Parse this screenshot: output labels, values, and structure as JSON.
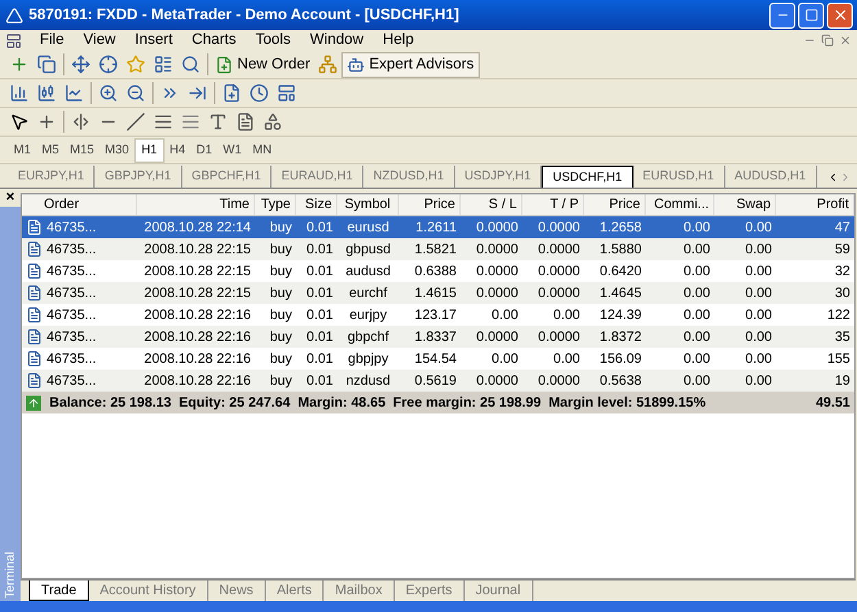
{
  "window": {
    "title": "5870191: FXDD - MetaTrader - Demo Account - [USDCHF,H1]"
  },
  "menu": [
    "File",
    "View",
    "Insert",
    "Charts",
    "Tools",
    "Window",
    "Help"
  ],
  "toolbar": {
    "new_order": "New Order",
    "expert_advisors": "Expert Advisors"
  },
  "timeframes": [
    {
      "label": "M1",
      "selected": false
    },
    {
      "label": "M5",
      "selected": false
    },
    {
      "label": "M15",
      "selected": false
    },
    {
      "label": "M30",
      "selected": false
    },
    {
      "label": "H1",
      "selected": true
    },
    {
      "label": "H4",
      "selected": false
    },
    {
      "label": "D1",
      "selected": false
    },
    {
      "label": "W1",
      "selected": false
    },
    {
      "label": "MN",
      "selected": false
    }
  ],
  "chart_tabs": [
    {
      "label": "EURJPY,H1",
      "selected": false
    },
    {
      "label": "GBPJPY,H1",
      "selected": false
    },
    {
      "label": "GBPCHF,H1",
      "selected": false
    },
    {
      "label": "EURAUD,H1",
      "selected": false
    },
    {
      "label": "NZDUSD,H1",
      "selected": false
    },
    {
      "label": "USDJPY,H1",
      "selected": false
    },
    {
      "label": "USDCHF,H1",
      "selected": true
    },
    {
      "label": "EURUSD,H1",
      "selected": false
    },
    {
      "label": "AUDUSD,H1",
      "selected": false
    }
  ],
  "terminal": {
    "close": "×",
    "side_label": "Terminal",
    "columns": [
      "Order",
      "Time",
      "Type",
      "Size",
      "Symbol",
      "Price",
      "S / L",
      "T / P",
      "Price",
      "Commi...",
      "Swap",
      "Profit"
    ],
    "rows": [
      {
        "selected": true,
        "cells": [
          "46735...",
          "2008.10.28 22:14",
          "buy",
          "0.01",
          "eurusd",
          "1.2611",
          "0.0000",
          "0.0000",
          "1.2658",
          "0.00",
          "0.00",
          "47"
        ]
      },
      {
        "selected": false,
        "cells": [
          "46735...",
          "2008.10.28 22:15",
          "buy",
          "0.01",
          "gbpusd",
          "1.5821",
          "0.0000",
          "0.0000",
          "1.5880",
          "0.00",
          "0.00",
          "59"
        ]
      },
      {
        "selected": false,
        "cells": [
          "46735...",
          "2008.10.28 22:15",
          "buy",
          "0.01",
          "audusd",
          "0.6388",
          "0.0000",
          "0.0000",
          "0.6420",
          "0.00",
          "0.00",
          "32"
        ]
      },
      {
        "selected": false,
        "cells": [
          "46735...",
          "2008.10.28 22:15",
          "buy",
          "0.01",
          "eurchf",
          "1.4615",
          "0.0000",
          "0.0000",
          "1.4645",
          "0.00",
          "0.00",
          "30"
        ]
      },
      {
        "selected": false,
        "cells": [
          "46735...",
          "2008.10.28 22:16",
          "buy",
          "0.01",
          "eurjpy",
          "123.17",
          "0.00",
          "0.00",
          "124.39",
          "0.00",
          "0.00",
          "122"
        ]
      },
      {
        "selected": false,
        "cells": [
          "46735...",
          "2008.10.28 22:16",
          "buy",
          "0.01",
          "gbpchf",
          "1.8337",
          "0.0000",
          "0.0000",
          "1.8372",
          "0.00",
          "0.00",
          "35"
        ]
      },
      {
        "selected": false,
        "cells": [
          "46735...",
          "2008.10.28 22:16",
          "buy",
          "0.01",
          "gbpjpy",
          "154.54",
          "0.00",
          "0.00",
          "156.09",
          "0.00",
          "0.00",
          "155"
        ]
      },
      {
        "selected": false,
        "cells": [
          "46735...",
          "2008.10.28 22:16",
          "buy",
          "0.01",
          "nzdusd",
          "0.5619",
          "0.0000",
          "0.0000",
          "0.5638",
          "0.00",
          "0.00",
          "19"
        ]
      }
    ],
    "summary": {
      "text": "Balance: 25 198.13  Equity: 25 247.64  Margin: 48.65  Free margin: 25 198.99  Margin level: 51899.15%",
      "profit": "49.51"
    },
    "tabs": [
      {
        "label": "Trade",
        "selected": true
      },
      {
        "label": "Account History",
        "selected": false
      },
      {
        "label": "News",
        "selected": false
      },
      {
        "label": "Alerts",
        "selected": false
      },
      {
        "label": "Mailbox",
        "selected": false
      },
      {
        "label": "Experts",
        "selected": false
      },
      {
        "label": "Journal",
        "selected": false
      }
    ]
  }
}
